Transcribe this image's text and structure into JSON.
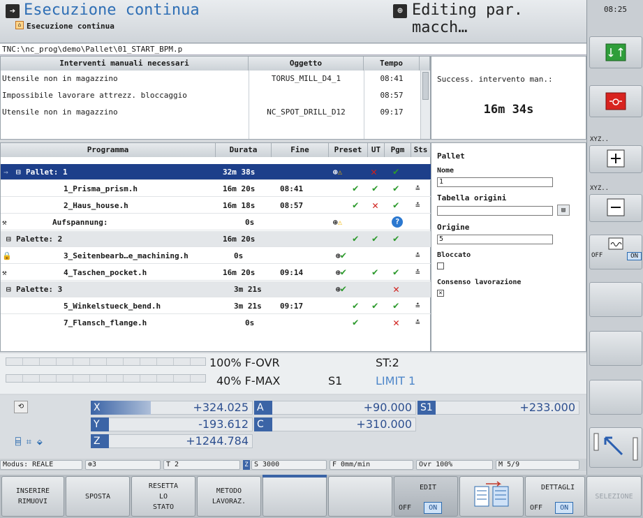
{
  "header": {
    "title": "Esecuzione continua",
    "subtitle": "Esecuzione continua",
    "editing": "Editing par. macch…",
    "clock": "08:25"
  },
  "path": "TNC:\\nc_prog\\demo\\Pallet\\01_START_BPM.p",
  "interventions": {
    "headers": [
      "Interventi manuali necessari",
      "Oggetto",
      "Tempo"
    ],
    "rows": [
      {
        "text": "Utensile non in magazzino",
        "object": "TORUS_MILL_D4_1",
        "time": "08:41"
      },
      {
        "text": "Impossibile lavorare attrezz. bloccaggio",
        "object": "",
        "time": "08:57"
      },
      {
        "text": "Utensile non in magazzino",
        "object": "NC_SPOT_DRILL_D12",
        "time": "09:17"
      }
    ],
    "next_label": "Success. intervento man.:",
    "next_value": "16m 34s"
  },
  "program": {
    "headers": [
      "Programma",
      "Durata",
      "Fine",
      "Preset",
      "UT",
      "Pgm",
      "Sts"
    ],
    "rows": [
      {
        "name": "Pallet: 1",
        "dur": "32m 38s",
        "end": ""
      },
      {
        "name": "1_Prisma_prism.h",
        "dur": "16m 20s",
        "end": "08:41"
      },
      {
        "name": "2_Haus_house.h",
        "dur": "16m 18s",
        "end": "08:57"
      },
      {
        "name": "Aufspannung:",
        "dur": "0s",
        "end": ""
      },
      {
        "name": "Palette: 2",
        "dur": "16m 20s",
        "end": ""
      },
      {
        "name": "3_Seitenbearb…e_machining.h",
        "dur": "0s",
        "end": ""
      },
      {
        "name": "4_Taschen_pocket.h",
        "dur": "16m 20s",
        "end": "09:14"
      },
      {
        "name": "Palette: 3",
        "dur": "3m 21s",
        "end": ""
      },
      {
        "name": "5_Winkelstueck_bend.h",
        "dur": "3m 21s",
        "end": "09:17"
      },
      {
        "name": "7_Flansch_flange.h",
        "dur": "0s",
        "end": ""
      }
    ]
  },
  "pallet": {
    "title": "Pallet",
    "name_label": "Nome",
    "name_value": "1",
    "table_label": "Tabella origini",
    "table_value": "",
    "origin_label": "Origine",
    "origin_value": "5",
    "locked_label": "Bloccato",
    "consent_label": "Consenso lavorazione"
  },
  "override": {
    "fovr": "100% F-OVR",
    "fmax": "40% F-MAX",
    "s1": "S1",
    "st": "ST:2",
    "limit": "LIMIT 1"
  },
  "positions": {
    "x_label": "X",
    "x_value": "+324.025",
    "y_label": "Y",
    "y_value": "-193.612",
    "z_label": "Z",
    "z_value": "+1244.784",
    "a_label": "A",
    "a_value": "+90.000",
    "c_label": "C",
    "c_value": "+310.000",
    "s1_label": "S1",
    "s1_value": "+233.000"
  },
  "status_bar": {
    "mode": "Modus: REALE",
    "preset": "3",
    "tool": "T 2",
    "spindle": "S 3000",
    "feed": "F 0mm/min",
    "ovr": "Ovr 100%",
    "m": "M 5/9"
  },
  "softkeys": {
    "k1": "INSERIRE\nRIMUOVI",
    "k2": "SPOSTA",
    "k3": "RESETTA\nLO\nSTATO",
    "k4": "METODO\nLAVORAZ.",
    "edit": "EDIT",
    "off": "OFF",
    "on": "ON",
    "details": "DETTAGLI",
    "select": "SELEZIONE"
  },
  "side": {
    "xyz1": "XYZ..",
    "xyz2": "XYZ..",
    "off": "OFF",
    "on": "ON"
  }
}
